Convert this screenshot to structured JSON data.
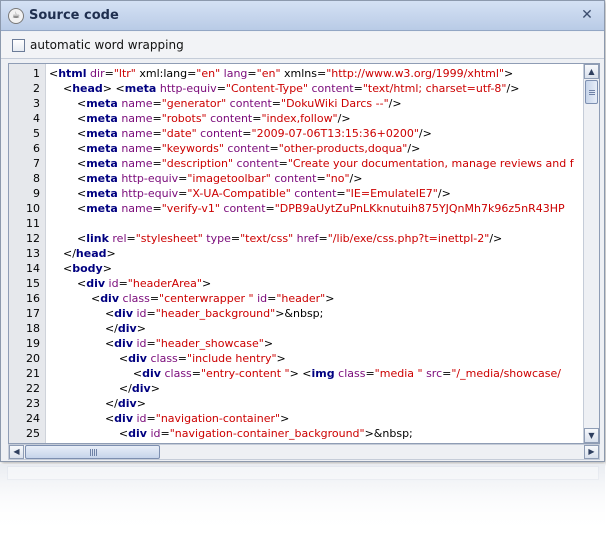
{
  "window": {
    "title": "Source code",
    "icon": "java-cup-icon",
    "close_glyph": "✕"
  },
  "options": {
    "word_wrap_label": "automatic word wrapping",
    "word_wrap_checked": false
  },
  "source": {
    "lines": [
      {
        "n": "1",
        "tokens": [
          [
            "p",
            "<"
          ],
          [
            "t",
            "html"
          ],
          [
            "p",
            " "
          ],
          [
            "a",
            "dir"
          ],
          [
            "p",
            "="
          ],
          [
            "v",
            "\"ltr\""
          ],
          [
            "p",
            " xml:lang="
          ],
          [
            "v",
            "\"en\""
          ],
          [
            "p",
            " "
          ],
          [
            "a",
            "lang"
          ],
          [
            "p",
            "="
          ],
          [
            "v",
            "\"en\""
          ],
          [
            "p",
            " xmlns="
          ],
          [
            "v",
            "\"http://www.w3.org/1999/xhtml\""
          ],
          [
            "p",
            ">"
          ]
        ]
      },
      {
        "n": "2",
        "tokens": [
          [
            "p",
            "    <"
          ],
          [
            "t",
            "head"
          ],
          [
            "p",
            "> <"
          ],
          [
            "t",
            "meta"
          ],
          [
            "p",
            " "
          ],
          [
            "a",
            "http-equiv"
          ],
          [
            "p",
            "="
          ],
          [
            "v",
            "\"Content-Type\""
          ],
          [
            "p",
            " "
          ],
          [
            "a",
            "content"
          ],
          [
            "p",
            "="
          ],
          [
            "v",
            "\"text/html; charset=utf-8\""
          ],
          [
            "p",
            "/>"
          ]
        ]
      },
      {
        "n": "3",
        "tokens": [
          [
            "p",
            "        <"
          ],
          [
            "t",
            "meta"
          ],
          [
            "p",
            " "
          ],
          [
            "a",
            "name"
          ],
          [
            "p",
            "="
          ],
          [
            "v",
            "\"generator\""
          ],
          [
            "p",
            " "
          ],
          [
            "a",
            "content"
          ],
          [
            "p",
            "="
          ],
          [
            "v",
            "\"DokuWiki Darcs --\""
          ],
          [
            "p",
            "/>"
          ]
        ]
      },
      {
        "n": "4",
        "tokens": [
          [
            "p",
            "        <"
          ],
          [
            "t",
            "meta"
          ],
          [
            "p",
            " "
          ],
          [
            "a",
            "name"
          ],
          [
            "p",
            "="
          ],
          [
            "v",
            "\"robots\""
          ],
          [
            "p",
            " "
          ],
          [
            "a",
            "content"
          ],
          [
            "p",
            "="
          ],
          [
            "v",
            "\"index,follow\""
          ],
          [
            "p",
            "/>"
          ]
        ]
      },
      {
        "n": "5",
        "tokens": [
          [
            "p",
            "        <"
          ],
          [
            "t",
            "meta"
          ],
          [
            "p",
            " "
          ],
          [
            "a",
            "name"
          ],
          [
            "p",
            "="
          ],
          [
            "v",
            "\"date\""
          ],
          [
            "p",
            " "
          ],
          [
            "a",
            "content"
          ],
          [
            "p",
            "="
          ],
          [
            "v",
            "\"2009-07-06T13:15:36+0200\""
          ],
          [
            "p",
            "/>"
          ]
        ]
      },
      {
        "n": "6",
        "tokens": [
          [
            "p",
            "        <"
          ],
          [
            "t",
            "meta"
          ],
          [
            "p",
            " "
          ],
          [
            "a",
            "name"
          ],
          [
            "p",
            "="
          ],
          [
            "v",
            "\"keywords\""
          ],
          [
            "p",
            " "
          ],
          [
            "a",
            "content"
          ],
          [
            "p",
            "="
          ],
          [
            "v",
            "\"other-products,doqua\""
          ],
          [
            "p",
            "/>"
          ]
        ]
      },
      {
        "n": "7",
        "tokens": [
          [
            "p",
            "        <"
          ],
          [
            "t",
            "meta"
          ],
          [
            "p",
            " "
          ],
          [
            "a",
            "name"
          ],
          [
            "p",
            "="
          ],
          [
            "v",
            "\"description\""
          ],
          [
            "p",
            " "
          ],
          [
            "a",
            "content"
          ],
          [
            "p",
            "="
          ],
          [
            "v",
            "\"Create your documentation, manage reviews and f"
          ]
        ]
      },
      {
        "n": "8",
        "tokens": [
          [
            "p",
            "        <"
          ],
          [
            "t",
            "meta"
          ],
          [
            "p",
            " "
          ],
          [
            "a",
            "http-equiv"
          ],
          [
            "p",
            "="
          ],
          [
            "v",
            "\"imagetoolbar\""
          ],
          [
            "p",
            " "
          ],
          [
            "a",
            "content"
          ],
          [
            "p",
            "="
          ],
          [
            "v",
            "\"no\""
          ],
          [
            "p",
            "/>"
          ]
        ]
      },
      {
        "n": "9",
        "tokens": [
          [
            "p",
            "        <"
          ],
          [
            "t",
            "meta"
          ],
          [
            "p",
            " "
          ],
          [
            "a",
            "http-equiv"
          ],
          [
            "p",
            "="
          ],
          [
            "v",
            "\"X-UA-Compatible\""
          ],
          [
            "p",
            " "
          ],
          [
            "a",
            "content"
          ],
          [
            "p",
            "="
          ],
          [
            "v",
            "\"IE=EmulateIE7\""
          ],
          [
            "p",
            "/>"
          ]
        ]
      },
      {
        "n": "10",
        "tokens": [
          [
            "p",
            "        <"
          ],
          [
            "t",
            "meta"
          ],
          [
            "p",
            " "
          ],
          [
            "a",
            "name"
          ],
          [
            "p",
            "="
          ],
          [
            "v",
            "\"verify-v1\""
          ],
          [
            "p",
            " "
          ],
          [
            "a",
            "content"
          ],
          [
            "p",
            "="
          ],
          [
            "v",
            "\"DPB9aUytZuPnLKknutuih875YJQnMh7k96z5nR43HP"
          ]
        ]
      },
      {
        "n": "11",
        "tokens": []
      },
      {
        "n": "12",
        "tokens": [
          [
            "p",
            "        <"
          ],
          [
            "t",
            "link"
          ],
          [
            "p",
            " "
          ],
          [
            "a",
            "rel"
          ],
          [
            "p",
            "="
          ],
          [
            "v",
            "\"stylesheet\""
          ],
          [
            "p",
            " "
          ],
          [
            "a",
            "type"
          ],
          [
            "p",
            "="
          ],
          [
            "v",
            "\"text/css\""
          ],
          [
            "p",
            " "
          ],
          [
            "a",
            "href"
          ],
          [
            "p",
            "="
          ],
          [
            "v",
            "\"/lib/exe/css.php?t=inettpl-2\""
          ],
          [
            "p",
            "/>"
          ]
        ]
      },
      {
        "n": "13",
        "tokens": [
          [
            "p",
            "    </"
          ],
          [
            "t",
            "head"
          ],
          [
            "p",
            ">"
          ]
        ]
      },
      {
        "n": "14",
        "tokens": [
          [
            "p",
            "    <"
          ],
          [
            "t",
            "body"
          ],
          [
            "p",
            ">"
          ]
        ]
      },
      {
        "n": "15",
        "tokens": [
          [
            "p",
            "        <"
          ],
          [
            "t",
            "div"
          ],
          [
            "p",
            " "
          ],
          [
            "a",
            "id"
          ],
          [
            "p",
            "="
          ],
          [
            "v",
            "\"headerArea\""
          ],
          [
            "p",
            ">"
          ]
        ]
      },
      {
        "n": "16",
        "tokens": [
          [
            "p",
            "            <"
          ],
          [
            "t",
            "div"
          ],
          [
            "p",
            " "
          ],
          [
            "a",
            "class"
          ],
          [
            "p",
            "="
          ],
          [
            "v",
            "\"centerwrapper \""
          ],
          [
            "p",
            " "
          ],
          [
            "a",
            "id"
          ],
          [
            "p",
            "="
          ],
          [
            "v",
            "\"header\""
          ],
          [
            "p",
            ">"
          ]
        ]
      },
      {
        "n": "17",
        "tokens": [
          [
            "p",
            "                <"
          ],
          [
            "t",
            "div"
          ],
          [
            "p",
            " "
          ],
          [
            "a",
            "id"
          ],
          [
            "p",
            "="
          ],
          [
            "v",
            "\"header_background\""
          ],
          [
            "p",
            ">&nbsp;"
          ]
        ]
      },
      {
        "n": "18",
        "tokens": [
          [
            "p",
            "                </"
          ],
          [
            "t",
            "div"
          ],
          [
            "p",
            ">"
          ]
        ]
      },
      {
        "n": "19",
        "tokens": [
          [
            "p",
            "                <"
          ],
          [
            "t",
            "div"
          ],
          [
            "p",
            " "
          ],
          [
            "a",
            "id"
          ],
          [
            "p",
            "="
          ],
          [
            "v",
            "\"header_showcase\""
          ],
          [
            "p",
            ">"
          ]
        ]
      },
      {
        "n": "20",
        "tokens": [
          [
            "p",
            "                    <"
          ],
          [
            "t",
            "div"
          ],
          [
            "p",
            " "
          ],
          [
            "a",
            "class"
          ],
          [
            "p",
            "="
          ],
          [
            "v",
            "\"include hentry\""
          ],
          [
            "p",
            ">"
          ]
        ]
      },
      {
        "n": "21",
        "tokens": [
          [
            "p",
            "                        <"
          ],
          [
            "t",
            "div"
          ],
          [
            "p",
            " "
          ],
          [
            "a",
            "class"
          ],
          [
            "p",
            "="
          ],
          [
            "v",
            "\"entry-content \""
          ],
          [
            "p",
            "> <"
          ],
          [
            "t",
            "img"
          ],
          [
            "p",
            " "
          ],
          [
            "a",
            "class"
          ],
          [
            "p",
            "="
          ],
          [
            "v",
            "\"media \""
          ],
          [
            "p",
            " "
          ],
          [
            "a",
            "src"
          ],
          [
            "p",
            "="
          ],
          [
            "v",
            "\"/_media/showcase/"
          ]
        ]
      },
      {
        "n": "22",
        "tokens": [
          [
            "p",
            "                    </"
          ],
          [
            "t",
            "div"
          ],
          [
            "p",
            ">"
          ]
        ]
      },
      {
        "n": "23",
        "tokens": [
          [
            "p",
            "                </"
          ],
          [
            "t",
            "div"
          ],
          [
            "p",
            ">"
          ]
        ]
      },
      {
        "n": "24",
        "tokens": [
          [
            "p",
            "                <"
          ],
          [
            "t",
            "div"
          ],
          [
            "p",
            " "
          ],
          [
            "a",
            "id"
          ],
          [
            "p",
            "="
          ],
          [
            "v",
            "\"navigation-container\""
          ],
          [
            "p",
            ">"
          ]
        ]
      },
      {
        "n": "25",
        "tokens": [
          [
            "p",
            "                    <"
          ],
          [
            "t",
            "div"
          ],
          [
            "p",
            " "
          ],
          [
            "a",
            "id"
          ],
          [
            "p",
            "="
          ],
          [
            "v",
            "\"navigation-container_background\""
          ],
          [
            "p",
            ">&nbsp;"
          ]
        ]
      }
    ]
  },
  "scrollbars": {
    "up_glyph": "▲",
    "down_glyph": "▼",
    "left_glyph": "◀",
    "right_glyph": "▶"
  },
  "colors": {
    "tag": "#000080",
    "attribute": "#7a0a7a",
    "value": "#cc0000",
    "titlebar": "#c3d3ec"
  }
}
